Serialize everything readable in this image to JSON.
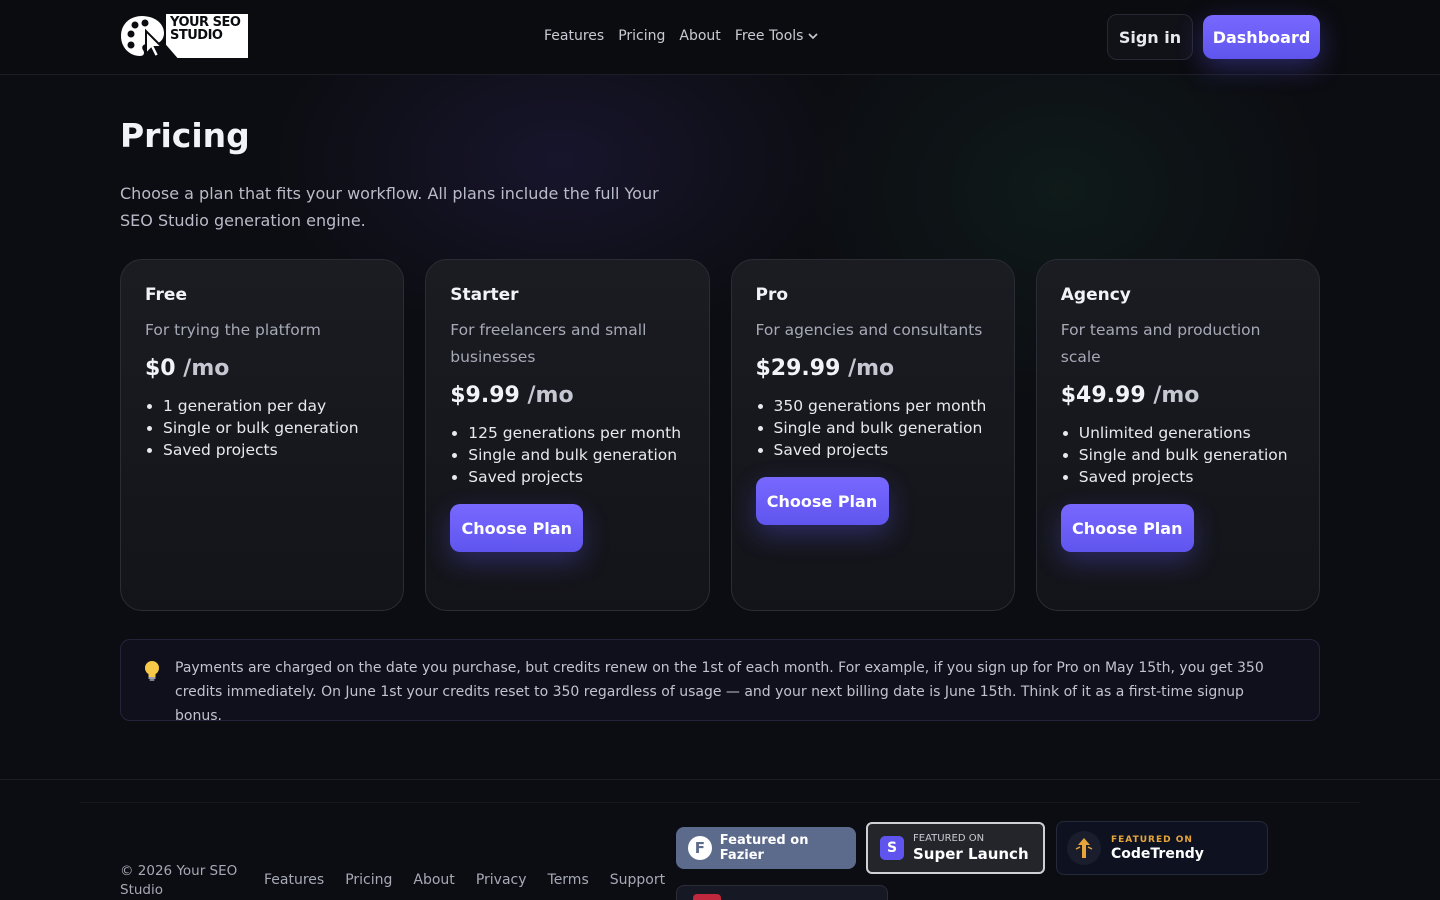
{
  "header": {
    "logo_text": "YOUR SEO STUDIO",
    "nav": [
      "Features",
      "Pricing",
      "About",
      "Free Tools"
    ],
    "signin_label": "Sign in",
    "dashboard_label": "Dashboard"
  },
  "page": {
    "title": "Pricing",
    "subtitle": "Choose a plan that fits your workflow. All plans include the full Your SEO Studio generation engine."
  },
  "plans": [
    {
      "name": "Free",
      "desc": "For trying the platform",
      "price": "$0",
      "per": "/mo",
      "features": [
        "1 generation per day",
        "Single or bulk generation",
        "Saved projects"
      ],
      "cta": ""
    },
    {
      "name": "Starter",
      "desc": "For freelancers and small businesses",
      "price": "$9.99",
      "per": "/mo",
      "features": [
        "125 generations per month",
        "Single and bulk generation",
        "Saved projects"
      ],
      "cta": "Choose Plan"
    },
    {
      "name": "Pro",
      "desc": "For agencies and consultants",
      "price": "$29.99",
      "per": "/mo",
      "features": [
        "350 generations per month",
        "Single and bulk generation",
        "Saved projects"
      ],
      "cta": "Choose Plan"
    },
    {
      "name": "Agency",
      "desc": "For teams and production scale",
      "price": "$49.99",
      "per": "/mo",
      "features": [
        "Unlimited generations",
        "Single and bulk generation",
        "Saved projects"
      ],
      "cta": "Choose Plan"
    }
  ],
  "notice": {
    "text": "Payments are charged on the date you purchase, but credits renew on the 1st of each month. For example, if you sign up for Pro on May 15th, you get 350 credits immediately. On June 1st your credits reset to 350 regardless of usage — and your next billing date is June 15th. Think of it as a first-time signup bonus.",
    "icon": "lightbulb-icon"
  },
  "footer": {
    "copyright": "© 2026 Your SEO Studio",
    "links": [
      "Features",
      "Pricing",
      "About",
      "Privacy",
      "Terms",
      "Support"
    ],
    "badges": {
      "fazier": "Featured on Fazier",
      "superlaunch_small": "FEATURED ON",
      "superlaunch_big": "Super Launch",
      "codetrendy_small": "FEATURED ON",
      "codetrendy_big": "CodeTrendy"
    }
  },
  "colors": {
    "accent": "#6a5ff7",
    "background": "#0c0d12",
    "card": "#17181e"
  }
}
